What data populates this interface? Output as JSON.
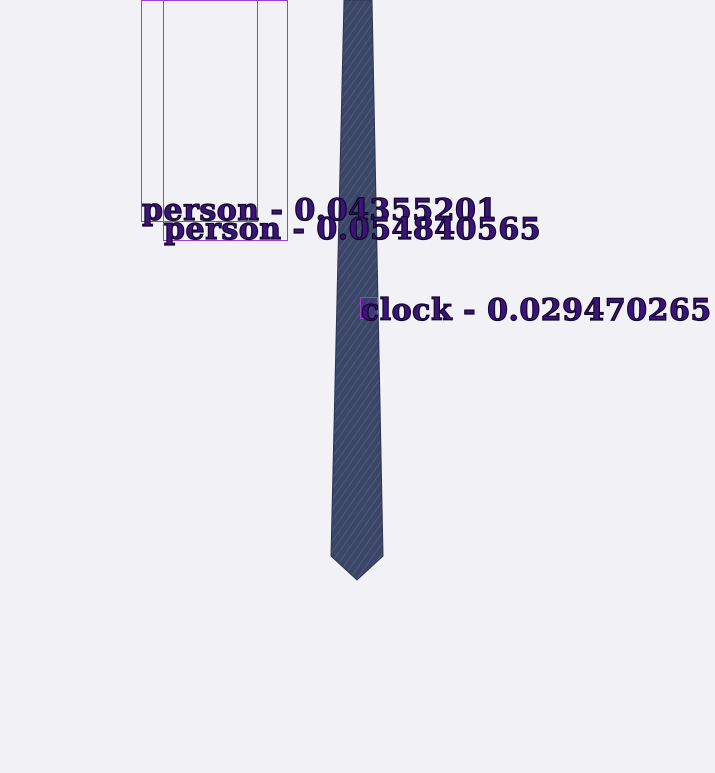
{
  "image": {
    "subject": "necktie",
    "tie_color": "#3b4666",
    "background_color": "#f2f2f6"
  },
  "detections": [
    {
      "label": "person - 0.04355201",
      "color": "#9b3fd6"
    },
    {
      "label": "person - 0.054840565",
      "color": "#9b3fd6"
    },
    {
      "label": "clock - 0.029470265",
      "color": "#9b3fd6"
    }
  ]
}
